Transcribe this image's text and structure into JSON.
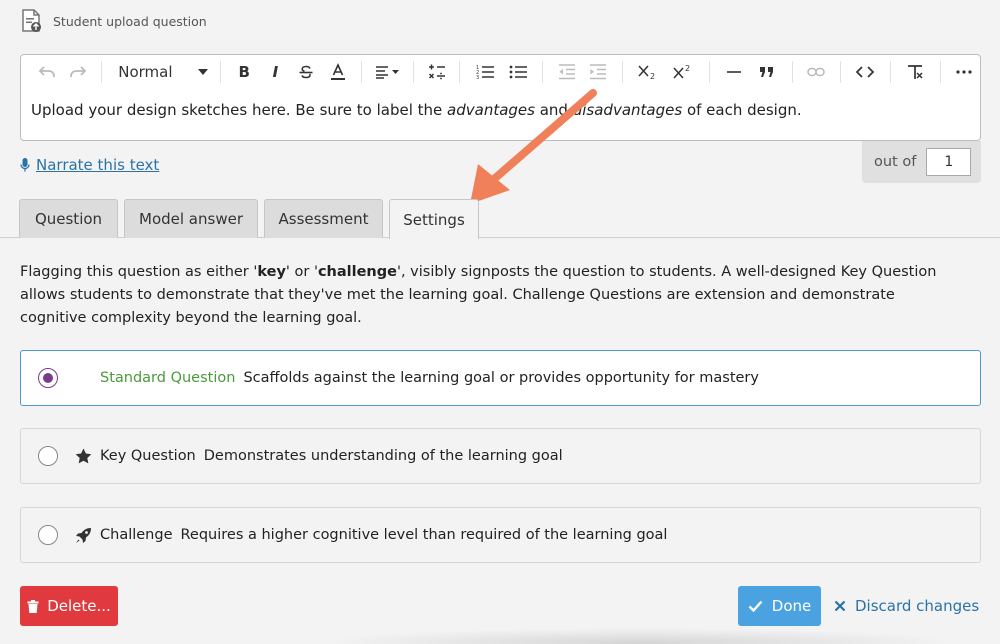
{
  "header": {
    "title": "Student upload question"
  },
  "toolbar": {
    "format_label": "Normal",
    "buttons": [
      "undo-icon",
      "redo-icon",
      "bold-icon",
      "italic-icon",
      "strikethrough-icon",
      "text-color-icon",
      "align-icon",
      "formula-icon",
      "ordered-list-icon",
      "bullet-list-icon",
      "outdent-icon",
      "indent-icon",
      "subscript-icon",
      "superscript-icon",
      "horizontal-rule-icon",
      "blockquote-icon",
      "link-icon",
      "code-icon",
      "clear-format-icon",
      "more-icon"
    ]
  },
  "editor": {
    "text_before": "Upload your design sketches here. Be sure to label the ",
    "em1": "advantages",
    "text_mid": " and ",
    "em2": "disadvantages",
    "text_after": " of each design."
  },
  "narrate": {
    "label": "Narrate this text"
  },
  "marks": {
    "label": "out of",
    "value": "1"
  },
  "tabs": [
    {
      "label": "Question",
      "active": false
    },
    {
      "label": "Model answer",
      "active": false
    },
    {
      "label": "Assessment",
      "active": false
    },
    {
      "label": "Settings",
      "active": true
    }
  ],
  "description": {
    "part1": "Flagging this question as either '",
    "key": "key",
    "part2": "' or '",
    "challenge": "challenge",
    "part3": "', visibly signposts the question to students. A well-designed Key Question allows students to demonstrate that they've met the learning goal. Challenge Questions are extension and demonstrate cognitive complexity beyond the learning goal."
  },
  "options": [
    {
      "name": "Standard Question",
      "desc": "Scaffolds against the learning goal or provides opportunity for mastery",
      "selected": true,
      "icon": ""
    },
    {
      "name": "Key Question",
      "desc": "Demonstrates understanding of the learning goal",
      "selected": false,
      "icon": "star-icon"
    },
    {
      "name": "Challenge",
      "desc": "Requires a higher cognitive level than required of the learning goal",
      "selected": false,
      "icon": "rocket-icon"
    }
  ],
  "actions": {
    "delete": "Delete...",
    "done": "Done",
    "discard": "Discard changes"
  },
  "colors": {
    "accent": "#4aa3e0",
    "danger": "#e0393e",
    "link": "#2a73a8",
    "standard_green": "#4a9a3a",
    "radio_selected": "#7a3c8c",
    "annotation_arrow": "#f0805a"
  }
}
